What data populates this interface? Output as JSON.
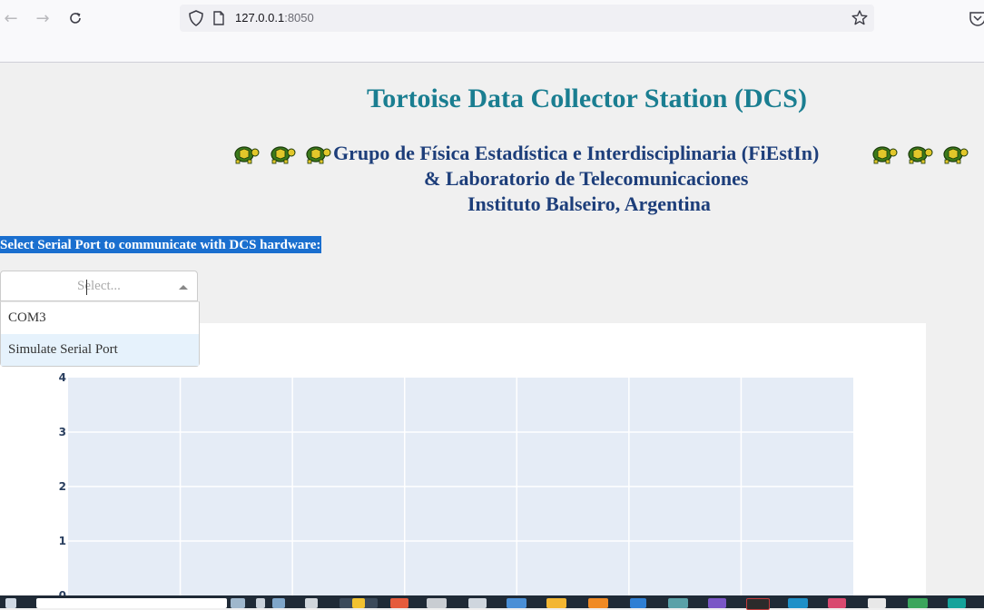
{
  "browser": {
    "url_host": "127.0.0.1",
    "url_port": ":8050"
  },
  "page": {
    "title": "Tortoise Data Collector Station (DCS)",
    "subtitle_line1": "Grupo de Física Estadística e Interdisciplinaria (FiEstIn)",
    "subtitle_line2": "& Laboratorio de Telecomunicaciones",
    "subtitle_line3": "Instituto Balseiro, Argentina",
    "serial_label": "Select Serial Port to communicate with DCS hardware:"
  },
  "serial_dropdown": {
    "placeholder": "Select...",
    "options": [
      "COM3",
      "Simulate Serial Port"
    ],
    "focused_option": "Simulate Serial Port"
  },
  "chart_data": {
    "type": "line",
    "series": [],
    "xlabel": "",
    "ylabel": "",
    "y_ticks": [
      "0",
      "1",
      "2",
      "3",
      "4"
    ],
    "ylim": [
      0,
      4
    ],
    "grid": true,
    "plot_bg": "#e5ecf6"
  },
  "colors": {
    "title": "#1a7e91",
    "subtitle": "#1d3e7a",
    "label_bg": "#1a6fcf"
  }
}
